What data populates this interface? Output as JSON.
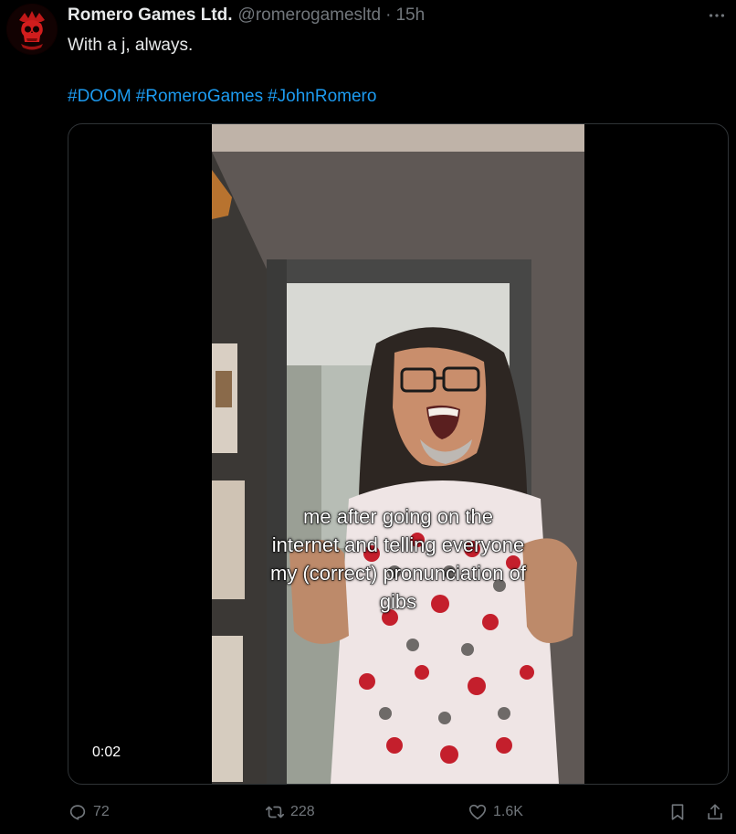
{
  "author": {
    "display_name": "Romero Games Ltd.",
    "handle": "@romerogamesltd",
    "separator": "·",
    "time": "15h",
    "avatar_icon": "skull-logo-icon"
  },
  "tweet": {
    "text": "With a j, always.",
    "hashtags": [
      "#DOOM",
      "#RomeroGames",
      "#JohnRomero"
    ]
  },
  "media": {
    "type": "video",
    "caption_lines": [
      "me after going on the",
      "internet and telling everyone",
      "my (correct) pronunciation of",
      "gibs"
    ],
    "timestamp": "0:02"
  },
  "actions": {
    "replies": {
      "icon": "reply-icon",
      "count": "72"
    },
    "reposts": {
      "icon": "repost-icon",
      "count": "228"
    },
    "likes": {
      "icon": "heart-icon",
      "count": "1.6K"
    },
    "bookmark": {
      "icon": "bookmark-icon"
    },
    "share": {
      "icon": "share-icon"
    }
  },
  "colors": {
    "background": "#000000",
    "text": "#e7e9ea",
    "muted": "#71767b",
    "link": "#1d9bf0",
    "border": "#2f3336"
  }
}
